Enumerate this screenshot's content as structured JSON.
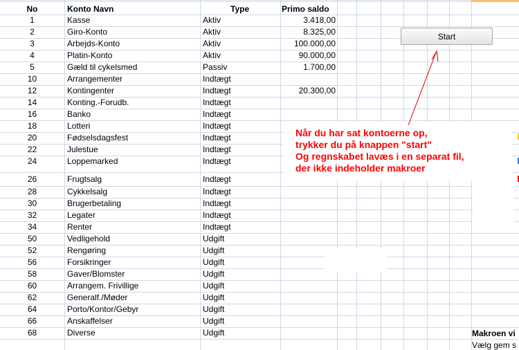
{
  "headers": {
    "no": "No",
    "name": "Konto Navn",
    "type": "Type",
    "saldo": "Primo saldo"
  },
  "rows": [
    {
      "no": "1",
      "name": "Kasse",
      "type": "Aktiv",
      "saldo": "3.418,00"
    },
    {
      "no": "2",
      "name": "Giro-Konto",
      "type": "Aktiv",
      "saldo": "8.325,00"
    },
    {
      "no": "3",
      "name": "Arbejds-Konto",
      "type": "Aktiv",
      "saldo": "100.000,00"
    },
    {
      "no": "4",
      "name": "Platin-Konto",
      "type": "Aktiv",
      "saldo": "90.000,00"
    },
    {
      "no": "5",
      "name": "Gæld til cykelsmed",
      "type": "Passiv",
      "saldo": "1.700,00"
    },
    {
      "no": "10",
      "name": "Arrangementer",
      "type": "Indtægt",
      "saldo": ""
    },
    {
      "no": "12",
      "name": "Kontingenter",
      "type": "Indtægt",
      "saldo": "20.300,00"
    },
    {
      "no": "14",
      "name": "Konting.-Forudb.",
      "type": "Indtægt",
      "saldo": ""
    },
    {
      "no": "16",
      "name": "Banko",
      "type": "Indtægt",
      "saldo": ""
    },
    {
      "no": "18",
      "name": "Lotteri",
      "type": "Indtægt",
      "saldo": ""
    },
    {
      "no": "20",
      "name": "Fødselsdagsfest",
      "type": "Indtægt",
      "saldo": ""
    },
    {
      "no": "22",
      "name": "Julestue",
      "type": "Indtægt",
      "saldo": ""
    },
    {
      "no": "24",
      "name": "Loppemarked",
      "type": "Indtægt",
      "saldo": ""
    },
    {
      "no": "26",
      "name": "Frugtsalg",
      "type": "Indtægt",
      "saldo": ""
    },
    {
      "no": "28",
      "name": "Cykkelsalg",
      "type": "Indtægt",
      "saldo": ""
    },
    {
      "no": "30",
      "name": "Brugerbetaling",
      "type": "Indtægt",
      "saldo": ""
    },
    {
      "no": "32",
      "name": "Legater",
      "type": "Indtægt",
      "saldo": ""
    },
    {
      "no": "34",
      "name": "Renter",
      "type": "Indtægt",
      "saldo": ""
    },
    {
      "no": "50",
      "name": "Vedligehold",
      "type": "Udgift",
      "saldo": ""
    },
    {
      "no": "52",
      "name": "Rengøring",
      "type": "Udgift",
      "saldo": ""
    },
    {
      "no": "56",
      "name": "Forsikringer",
      "type": "Udgift",
      "saldo": ""
    },
    {
      "no": "58",
      "name": "Gaver/Blomster",
      "type": "Udgift",
      "saldo": ""
    },
    {
      "no": "60",
      "name": "Arrangem. Frivillige",
      "type": "Udgift",
      "saldo": ""
    },
    {
      "no": "62",
      "name": "Generalf./Møder",
      "type": "Udgift",
      "saldo": ""
    },
    {
      "no": "64",
      "name": "Porto/Kontor/Gebyr",
      "type": "Udgift",
      "saldo": ""
    },
    {
      "no": "66",
      "name": "Anskaffelser",
      "type": "Udgift",
      "saldo": ""
    },
    {
      "no": "68",
      "name": "Diverse",
      "type": "Udgift",
      "saldo": ""
    }
  ],
  "start_button": "Start",
  "annotation": [
    "Når du har sat kontoerne op,",
    "trykker du på knappen \"start\"",
    "Og regnskabet lavæs i en separat fil,",
    "der ikke indeholder makroer"
  ],
  "macro_title": "Makroen vi",
  "macro_text": "Vælg gem s",
  "colors": {
    "grid": "#d0d7e5",
    "annotation": "#ff0000",
    "arrow": "#cc0000"
  }
}
